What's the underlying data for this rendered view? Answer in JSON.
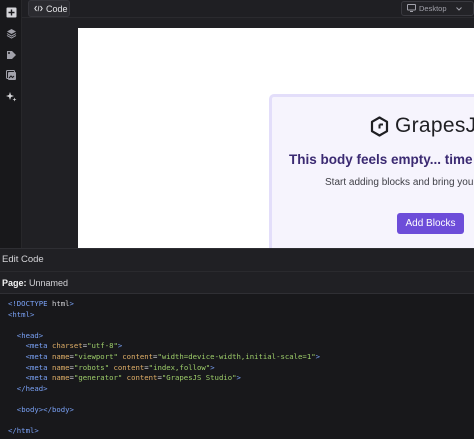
{
  "toolbar": {
    "code_label": "Code",
    "device": "Desktop"
  },
  "sidebar": {
    "icons": [
      "add-box-icon",
      "layers-icon",
      "styles-icon",
      "assets-icon",
      "ai-sparkle-icon"
    ]
  },
  "canvas": {
    "logo_text": "GrapesJ",
    "empty_title": "This body feels empty... time to",
    "empty_subtitle": "Start adding blocks and bring your",
    "add_blocks_label": "Add Blocks"
  },
  "code_panel": {
    "title": "Edit Code",
    "page_label": "Page:",
    "page_name": "Unnamed",
    "lines": [
      "<!DOCTYPE html>",
      "<html>",
      "",
      "  <head>",
      "    <meta charset=\"utf-8\">",
      "    <meta name=\"viewport\" content=\"width=device-width,initial-scale=1\">",
      "    <meta name=\"robots\" content=\"index,follow\">",
      "    <meta name=\"generator\" content=\"GrapesJS Studio\">",
      "  </head>",
      "",
      "  <body></body>",
      "",
      "</html>"
    ]
  },
  "colors": {
    "accent": "#6d4dd9",
    "title": "#3b2a72",
    "card_bg": "#f6f4fd"
  }
}
